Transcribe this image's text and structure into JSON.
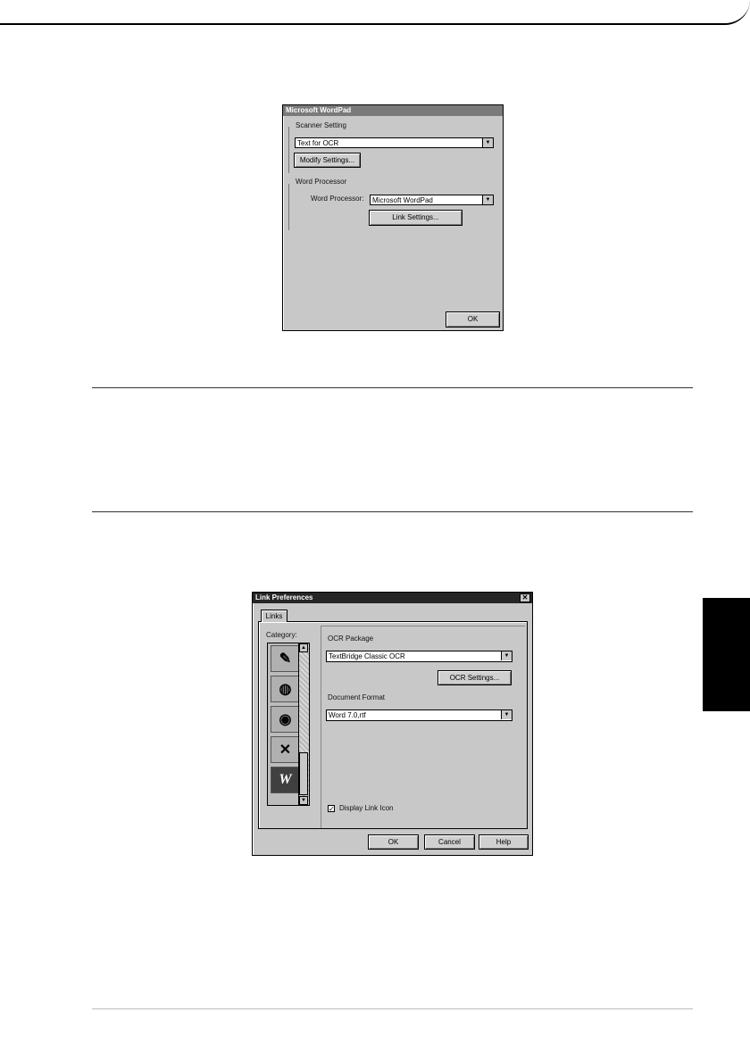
{
  "page": {
    "background": "#ffffff",
    "side_tab_color": "#000000"
  },
  "wordpad_dialog": {
    "title": "Microsoft WordPad",
    "scanner_group_label": "Scanner Setting",
    "scanner_value": "Text for OCR",
    "modify_button": "Modify Settings...",
    "word_group_label": "Word Processor",
    "word_processor_label": "Word Processor:",
    "word_processor_value": "Microsoft WordPad",
    "link_button": "Link Settings...",
    "ok_button": "OK"
  },
  "link_dialog": {
    "title": "Link Preferences",
    "close_icon": "close-icon",
    "tab_label": "Links",
    "category_label": "Category:",
    "categories": [
      {
        "icon": "paint-brush-icon",
        "glyph": "✎"
      },
      {
        "icon": "palette-icon",
        "glyph": "◍"
      },
      {
        "icon": "eye-icon",
        "glyph": "◉"
      },
      {
        "icon": "x-document-icon",
        "glyph": "✕"
      },
      {
        "icon": "word-w-icon",
        "glyph": "W"
      }
    ],
    "ocr_package_label": "OCR Package",
    "ocr_package_value": "TextBridge Classic OCR",
    "ocr_settings_button": "OCR Settings...",
    "document_format_label": "Document Format",
    "document_format_value": "Word 7.0,rtf",
    "display_link_icon_label": "Display Link Icon",
    "display_link_icon_checked": "✓",
    "ok_button": "OK",
    "cancel_button": "Cancel",
    "help_button": "Help"
  }
}
